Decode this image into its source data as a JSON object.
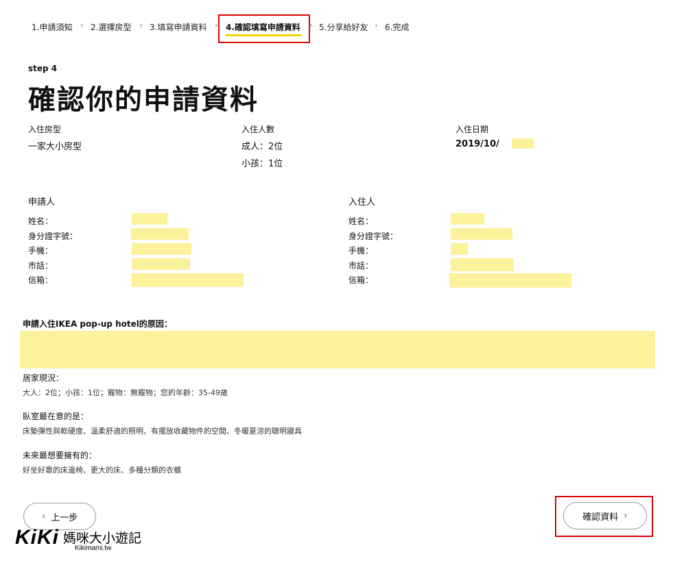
{
  "breadcrumb": {
    "steps": [
      {
        "label": "1.申請須知"
      },
      {
        "label": "2.選擇房型"
      },
      {
        "label": "3.填寫申請資料"
      },
      {
        "label": "4.確認填寫申請資料"
      },
      {
        "label": "5.分享給好友"
      },
      {
        "label": "6.完成"
      }
    ],
    "separator": "›",
    "active_index": 3
  },
  "header": {
    "step_label": "step 4",
    "title": "確認你的申請資料"
  },
  "summary": {
    "room_type_label": "入住房型",
    "room_type_value": "一家大小房型",
    "guests_label": "入住人數",
    "adults": "成人：2位",
    "children": "小孩：1位",
    "date_label": "入住日期",
    "date_value": "2019/10/"
  },
  "applicant": {
    "title": "申請人",
    "fields": [
      "姓名：",
      "身分證字號：",
      "手機：",
      "市話：",
      "信箱："
    ]
  },
  "resident": {
    "title": "入住人",
    "fields": [
      "姓名：",
      "身分證字號：",
      "手機：",
      "市話：",
      "信箱："
    ]
  },
  "reason": {
    "label": "申請入住IKEA pop-up hotel的原因："
  },
  "details": {
    "home_label": "居家現況：",
    "home_value": "大人：2位；小孩：1位；寵物：無寵物；您的年齡：35-49歲",
    "bedroom_label": "臥室最在意的是：",
    "bedroom_value": "床墊彈性與軟硬度、溫柔舒適的照明、有擺放收藏物件的空間、冬暖夏涼的聰明寢具",
    "future_label": "未來最想要擁有的：",
    "future_value": "好坐好靠的床邊椅、更大的床、多種分類的衣櫃"
  },
  "buttons": {
    "back": "上一步",
    "confirm": "確認資料",
    "back_chevron": "‹",
    "confirm_chevron": "›"
  },
  "watermark": {
    "logo": "KiKi",
    "text": "媽咪大小遊記",
    "url": "Kikimami.tw"
  },
  "colors": {
    "highlight": "#fdf29c",
    "accent_underline": "#f6d000",
    "annotation_red": "#e00000"
  }
}
